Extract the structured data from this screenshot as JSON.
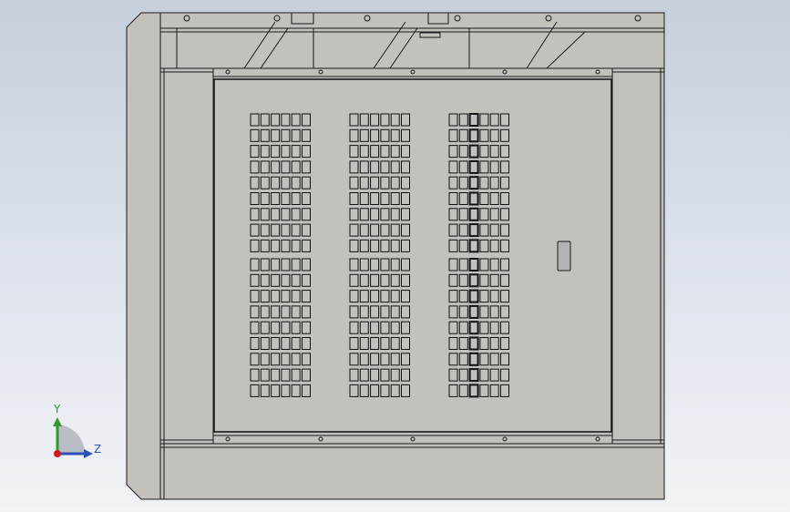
{
  "view": {
    "background": [
      "#c7cfdc",
      "#f1f3f6"
    ],
    "model_fill": "#c4c0bc",
    "edge_color": "#1a1a1a"
  },
  "triad": {
    "y_label": "Y",
    "z_label": "Z",
    "y_color": "#2e9a2e",
    "z_color": "#2d4fb8",
    "x_color": "#d01818"
  },
  "vent_pattern": {
    "columns_of_groups": 3,
    "slots_per_group_row": 6,
    "upper_block_rows": 9,
    "lower_block_rows": 9
  }
}
